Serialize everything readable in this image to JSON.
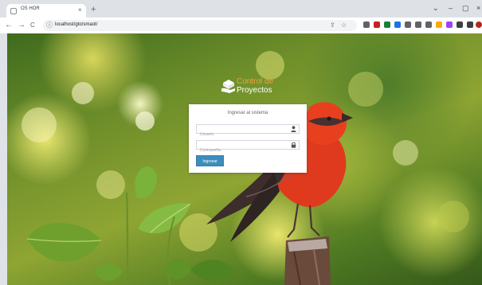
{
  "browser": {
    "tab": {
      "title": "OS HOR",
      "close": "×",
      "favicon": "document-icon"
    },
    "new_tab": "+",
    "window_controls": {
      "expand": "⌄",
      "minimize": "–",
      "maximize": "▢",
      "close": "×"
    },
    "nav": {
      "back": "←",
      "forward": "→",
      "reload": "C"
    },
    "address": {
      "info_icon": "ⓘ",
      "url": "localhost/gto/smaot/",
      "share_icon": "⇪",
      "bookmark_icon": "☆"
    },
    "extension_colors": [
      "#5f6368",
      "#c5221f",
      "#188038",
      "#1a73e8",
      "#5f6368",
      "#5f6368",
      "#5f6368",
      "#f9ab00",
      "#a142f4",
      "#3c4043",
      "#3c4043",
      "#b3261e"
    ]
  },
  "logo": {
    "line1": "Control de",
    "line2": "Proyectos",
    "icon": "cube-hand-icon"
  },
  "login": {
    "title": "Ingresar al sistema",
    "username_placeholder": "Usuario",
    "password_placeholder": "Contraseña",
    "submit_label": "Ingresar"
  },
  "colors": {
    "accent": "#3c8dbc",
    "logo_orange": "#f0a23a",
    "bird_red": "#e03a1e"
  }
}
